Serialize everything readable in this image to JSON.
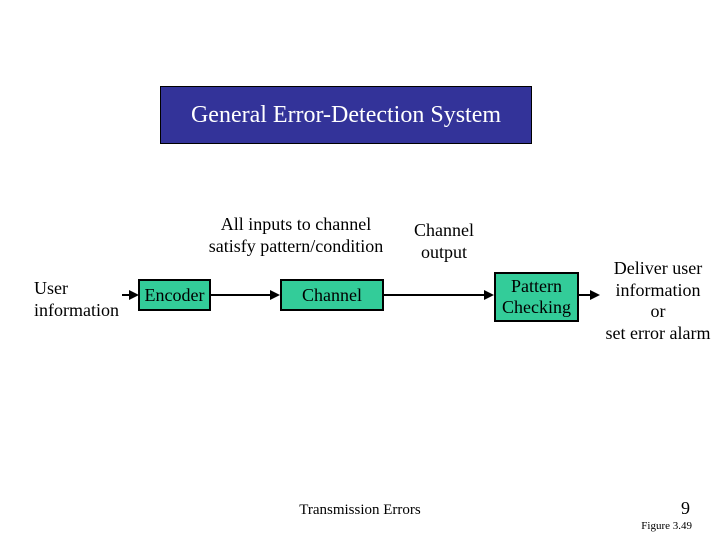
{
  "title": "General Error-Detection System",
  "labels": {
    "user_info_l1": "User",
    "user_info_l2": "information",
    "inputs_l1": "All inputs to channel",
    "inputs_l2": "satisfy pattern/condition",
    "chan_out_l1": "Channel",
    "chan_out_l2": "output",
    "deliver_l1": "Deliver user",
    "deliver_l2": "information",
    "deliver_l3": "or",
    "deliver_l4": "set error alarm"
  },
  "blocks": {
    "encoder": "Encoder",
    "channel": "Channel",
    "pattern_l1": "Pattern",
    "pattern_l2": "Checking"
  },
  "footer": {
    "center": "Transmission Errors",
    "page": "9",
    "figure": "Figure 3.49"
  }
}
